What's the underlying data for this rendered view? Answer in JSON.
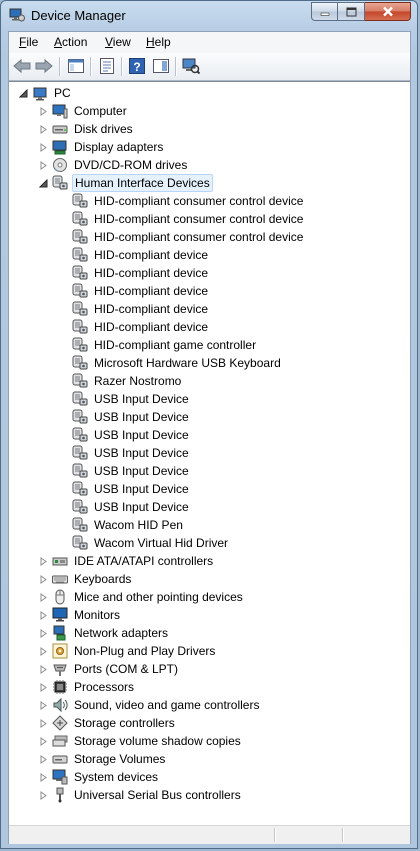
{
  "window": {
    "title": "Device Manager"
  },
  "menu": [
    "File",
    "Action",
    "View",
    "Help"
  ],
  "toolbar": {
    "icons": [
      "back-arrow-icon",
      "forward-arrow-icon",
      "show-hide-console-tree-icon",
      "properties-icon",
      "help-icon",
      "scan-hardware-icon"
    ]
  },
  "tree": {
    "root": "PC",
    "categories": [
      {
        "label": "Computer",
        "icon": "computer-icon",
        "expanded": false
      },
      {
        "label": "Disk drives",
        "icon": "disk-drive-icon",
        "expanded": false
      },
      {
        "label": "Display adapters",
        "icon": "display-adapter-icon",
        "expanded": false
      },
      {
        "label": "DVD/CD-ROM drives",
        "icon": "dvd-drive-icon",
        "expanded": false
      },
      {
        "label": "Human Interface Devices",
        "icon": "hid-icon",
        "expanded": true,
        "selected": true,
        "children": [
          "HID-compliant consumer control device",
          "HID-compliant consumer control device",
          "HID-compliant consumer control device",
          "HID-compliant device",
          "HID-compliant device",
          "HID-compliant device",
          "HID-compliant device",
          "HID-compliant device",
          "HID-compliant game controller",
          "Microsoft Hardware USB Keyboard",
          "Razer Nostromo",
          "USB Input Device",
          "USB Input Device",
          "USB Input Device",
          "USB Input Device",
          "USB Input Device",
          "USB Input Device",
          "USB Input Device",
          "Wacom HID Pen",
          "Wacom Virtual Hid Driver"
        ]
      },
      {
        "label": "IDE ATA/ATAPI controllers",
        "icon": "ide-controller-icon",
        "expanded": false
      },
      {
        "label": "Keyboards",
        "icon": "keyboard-icon",
        "expanded": false
      },
      {
        "label": "Mice and other pointing devices",
        "icon": "mouse-icon",
        "expanded": false
      },
      {
        "label": "Monitors",
        "icon": "monitor-icon",
        "expanded": false
      },
      {
        "label": "Network adapters",
        "icon": "network-adapter-icon",
        "expanded": false
      },
      {
        "label": "Non-Plug and Play Drivers",
        "icon": "non-pnp-driver-icon",
        "expanded": false
      },
      {
        "label": "Ports (COM & LPT)",
        "icon": "port-icon",
        "expanded": false
      },
      {
        "label": "Processors",
        "icon": "processor-icon",
        "expanded": false
      },
      {
        "label": "Sound, video and game controllers",
        "icon": "sound-icon",
        "expanded": false
      },
      {
        "label": "Storage controllers",
        "icon": "storage-controller-icon",
        "expanded": false
      },
      {
        "label": "Storage volume shadow copies",
        "icon": "shadow-copy-icon",
        "expanded": false
      },
      {
        "label": "Storage Volumes",
        "icon": "storage-volume-icon",
        "expanded": false
      },
      {
        "label": "System devices",
        "icon": "system-device-icon",
        "expanded": false
      },
      {
        "label": "Universal Serial Bus controllers",
        "icon": "usb-controller-icon",
        "expanded": false
      }
    ]
  },
  "colors": {
    "selection_bg": "#e5f1fb",
    "selection_border": "#b8d6fb",
    "titlebar": "#b9d1ea",
    "close_button": "#c84a2f"
  }
}
